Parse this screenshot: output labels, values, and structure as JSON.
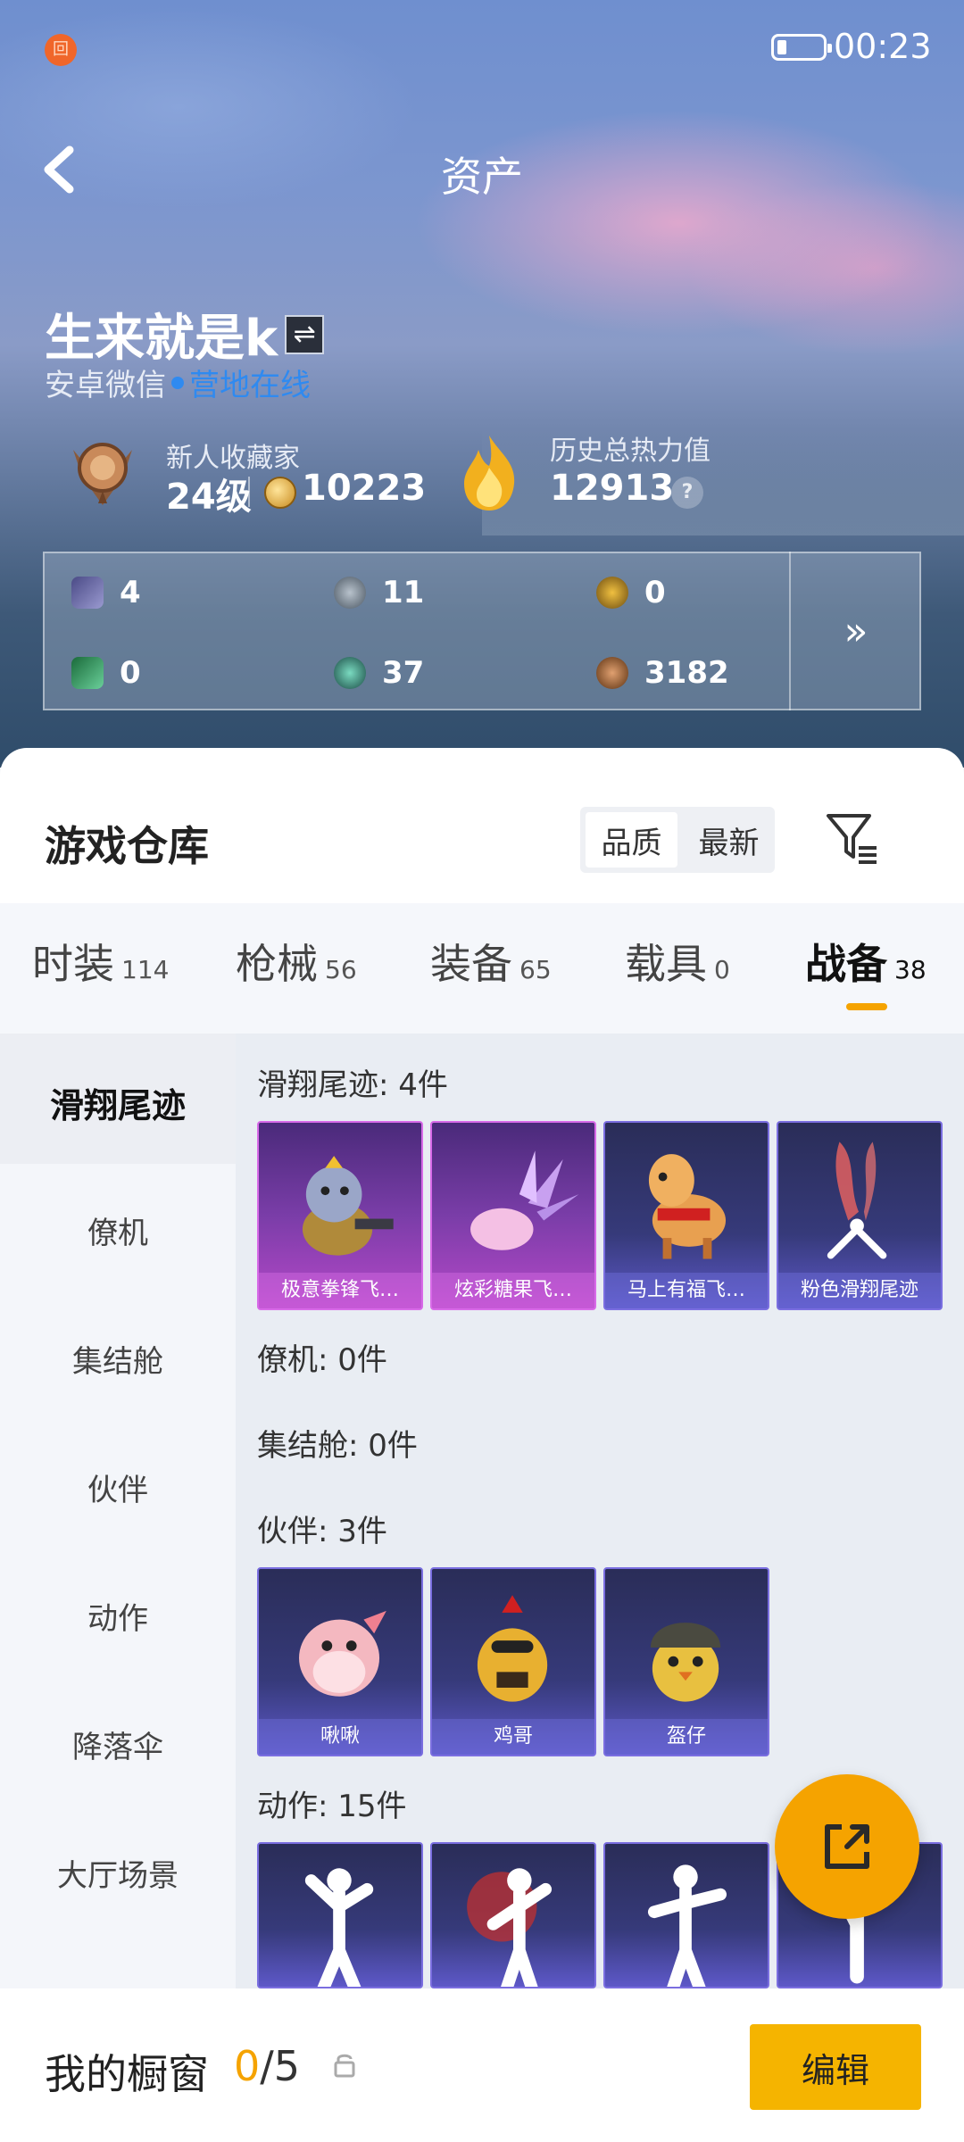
{
  "status_bar": {
    "time": "00:23",
    "notif_glyph": "回"
  },
  "header": {
    "title": "资产"
  },
  "profile": {
    "username": "生来就是k",
    "swap_glyph": "⇌",
    "platform": "安卓微信",
    "online_status": "营地在线",
    "rank_title": "新人收藏家",
    "level": "24级",
    "coins": "10223",
    "heat_title": "历史总热力值",
    "heat_value": "12913",
    "help_glyph": "?"
  },
  "currencies": [
    {
      "icon": "purple-card-icon",
      "value": "4"
    },
    {
      "icon": "silver-coin-icon",
      "value": "11"
    },
    {
      "icon": "gold-medal-icon",
      "value": "0"
    },
    {
      "icon": "green-ticket-icon",
      "value": "0"
    },
    {
      "icon": "teal-gem-icon",
      "value": "37"
    },
    {
      "icon": "bronze-coin-icon",
      "value": "3182"
    }
  ],
  "currency_more_glyph": "»",
  "warehouse": {
    "title": "游戏仓库",
    "sort_options": [
      "品质",
      "最新"
    ],
    "sort_selected": "品质"
  },
  "tabs": [
    {
      "label": "时装",
      "count": "114"
    },
    {
      "label": "枪械",
      "count": "56"
    },
    {
      "label": "装备",
      "count": "65"
    },
    {
      "label": "载具",
      "count": "0"
    },
    {
      "label": "战备",
      "count": "38"
    }
  ],
  "active_tab": "战备",
  "side_categories": [
    "滑翔尾迹",
    "僚机",
    "集结舱",
    "伙伴",
    "动作",
    "降落伞",
    "大厅场景"
  ],
  "sections": [
    {
      "head": "滑翔尾迹: 4件",
      "items": [
        "极意拳锋飞…",
        "炫彩糖果飞…",
        "马上有福飞…",
        "粉色滑翔尾迹"
      ]
    },
    {
      "head": "僚机: 0件"
    },
    {
      "head": "集结舱: 0件"
    },
    {
      "head": "伙伴: 3件",
      "items": [
        "啾啾",
        "鸡哥",
        "盔仔"
      ]
    },
    {
      "head": "动作: 15件"
    }
  ],
  "colors": {
    "accent": "#f5a300",
    "online": "#2f8af0"
  },
  "showcase": {
    "title": "我的橱窗",
    "current": "0",
    "total": "/5",
    "edit_label": "编辑"
  }
}
